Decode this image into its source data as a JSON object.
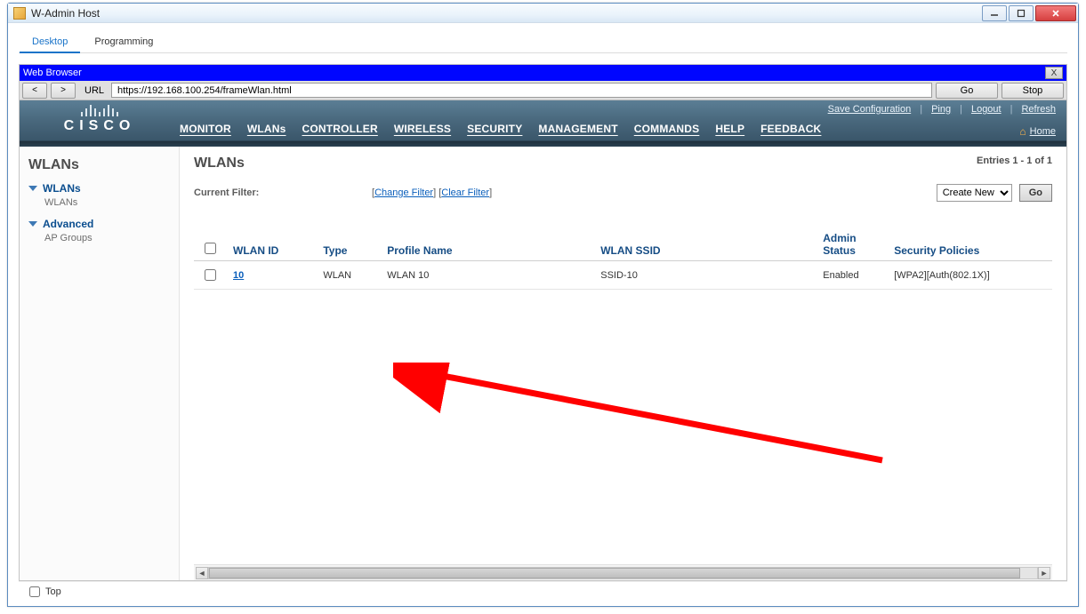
{
  "window": {
    "title": "W-Admin Host"
  },
  "app_tabs": {
    "desktop": "Desktop",
    "programming": "Programming"
  },
  "browser": {
    "title": "Web Browser",
    "url_label": "URL",
    "url_value": "https://192.168.100.254/frameWlan.html",
    "back": "<",
    "forward": ">",
    "go": "Go",
    "stop": "Stop",
    "close": "X"
  },
  "cisco": {
    "brand": "CISCO",
    "nav": {
      "monitor": "MONITOR",
      "wlans": "WLANs",
      "controller": "CONTROLLER",
      "wireless": "WIRELESS",
      "security": "SECURITY",
      "management": "MANAGEMENT",
      "commands": "COMMANDS",
      "help": "HELP",
      "feedback": "FEEDBACK"
    },
    "top_links": {
      "save_config": "Save Configuration",
      "ping": "Ping",
      "logout": "Logout",
      "refresh": "Refresh"
    },
    "home": "Home"
  },
  "sidebar": {
    "title": "WLANs",
    "groups": [
      {
        "label": "WLANs",
        "items": [
          "WLANs"
        ]
      },
      {
        "label": "Advanced",
        "items": [
          "AP Groups"
        ]
      }
    ]
  },
  "main": {
    "title": "WLANs",
    "entries": "Entries 1 - 1 of 1",
    "current_filter_label": "Current Filter:",
    "change_filter": "Change Filter",
    "clear_filter": "Clear Filter",
    "create_new": "Create New",
    "go": "Go",
    "columns": {
      "wlan_id": "WLAN ID",
      "type": "Type",
      "profile_name": "Profile Name",
      "wlan_ssid": "WLAN SSID",
      "admin_status": "Admin Status",
      "security_policies": "Security Policies"
    },
    "rows": [
      {
        "wlan_id": "10",
        "type": "WLAN",
        "profile_name": "WLAN 10",
        "wlan_ssid": "SSID-10",
        "admin_status": "Enabled",
        "security_policies": "[WPA2][Auth(802.1X)]"
      }
    ]
  },
  "footer": {
    "top": "Top"
  }
}
